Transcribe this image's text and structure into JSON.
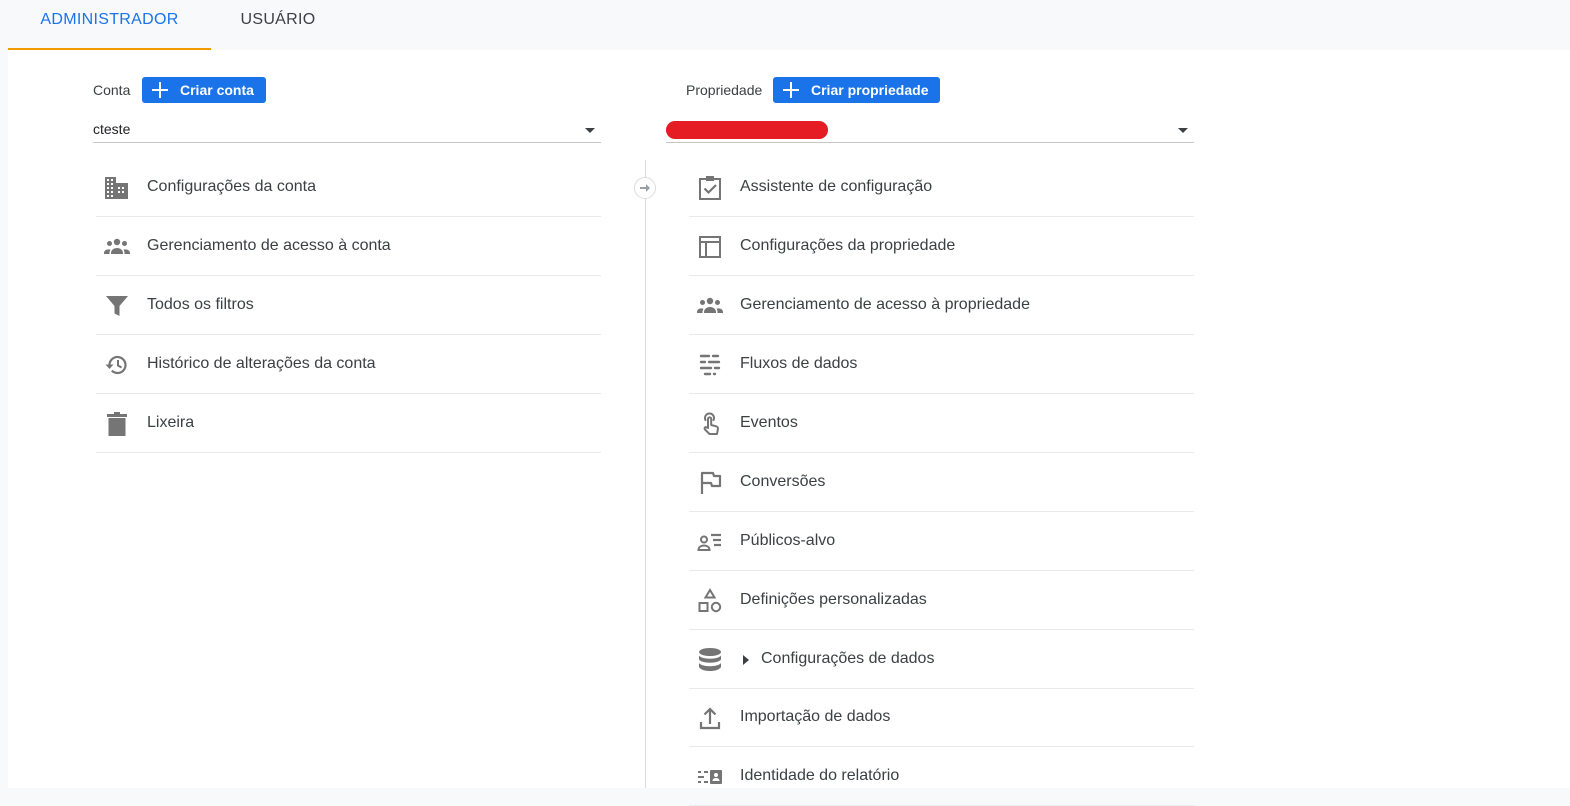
{
  "tabs": {
    "admin": "ADMINISTRADOR",
    "user": "USUÁRIO"
  },
  "account": {
    "label": "Conta",
    "create_button": "Criar conta",
    "selected": "cteste",
    "items": [
      {
        "label": "Configurações da conta",
        "icon": "building-icon"
      },
      {
        "label": "Gerenciamento de acesso à conta",
        "icon": "people-icon"
      },
      {
        "label": "Todos os filtros",
        "icon": "filter-icon"
      },
      {
        "label": "Histórico de alterações da conta",
        "icon": "history-icon"
      },
      {
        "label": "Lixeira",
        "icon": "trash-icon"
      }
    ]
  },
  "property": {
    "label": "Propriedade",
    "create_button": "Criar propriedade",
    "items": [
      {
        "label": "Assistente de configuração",
        "icon": "clipboard-check-icon"
      },
      {
        "label": "Configurações da propriedade",
        "icon": "layout-icon"
      },
      {
        "label": "Gerenciamento de acesso à propriedade",
        "icon": "people-icon"
      },
      {
        "label": "Fluxos de dados",
        "icon": "data-streams-icon"
      },
      {
        "label": "Eventos",
        "icon": "touch-icon"
      },
      {
        "label": "Conversões",
        "icon": "flag-icon"
      },
      {
        "label": "Públicos-alvo",
        "icon": "audience-icon"
      },
      {
        "label": "Definições personalizadas",
        "icon": "shapes-icon"
      },
      {
        "label": "Configurações de dados",
        "icon": "database-icon"
      },
      {
        "label": "Importação de dados",
        "icon": "upload-icon"
      },
      {
        "label": "Identidade do relatório",
        "icon": "report-identity-icon"
      }
    ]
  },
  "colors": {
    "accent": "#1a73e8",
    "tab_underline": "#f29900",
    "icon": "#757575",
    "redaction": "#e51c23"
  }
}
